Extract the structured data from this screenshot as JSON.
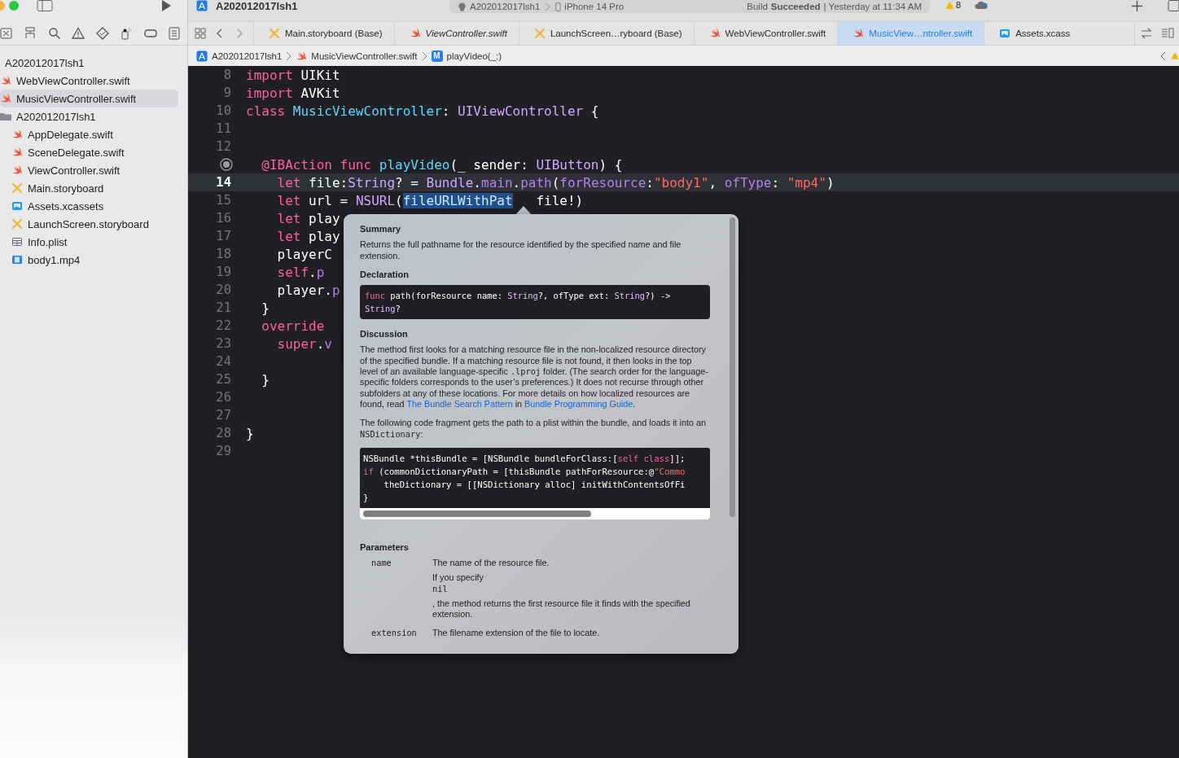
{
  "toolbar": {
    "project_title": "A202012017lsh1",
    "scheme": "A202012017lsh1",
    "device": "iPhone 14 Pro",
    "status": "Build **Succeeded** | Yesterday at 11:34 AM",
    "warning_count": "8"
  },
  "navigator": {
    "items": [
      {
        "kind": "group",
        "label": "A202012017lsh1",
        "selected": false,
        "children": [
          {
            "kind": "swift",
            "label": "WebViewController.swift",
            "selected": false
          },
          {
            "kind": "swift",
            "label": "MusicViewController.swift",
            "selected": true
          },
          {
            "kind": "folder",
            "label": "A202012017lsh1",
            "selected": false,
            "children": [
              {
                "kind": "swift",
                "label": "AppDelegate.swift",
                "selected": false
              },
              {
                "kind": "swift",
                "label": "SceneDelegate.swift",
                "selected": false
              },
              {
                "kind": "swift",
                "label": "ViewController.swift",
                "selected": false
              },
              {
                "kind": "storyboard",
                "label": "Main.storyboard",
                "selected": false
              },
              {
                "kind": "assets",
                "label": "Assets.xcassets",
                "selected": false
              },
              {
                "kind": "storyboard",
                "label": "LaunchScreen.storyboard",
                "selected": false
              },
              {
                "kind": "plist",
                "label": "Info.plist",
                "selected": false
              },
              {
                "kind": "video",
                "label": "body1.mp4",
                "selected": false
              }
            ]
          }
        ]
      }
    ]
  },
  "tabs": [
    {
      "kind": "storyboard",
      "label": "Main.storyboard (Base)",
      "preview": false,
      "selected": false
    },
    {
      "kind": "swift",
      "label": "ViewController.swift",
      "preview": true,
      "selected": false
    },
    {
      "kind": "storyboard",
      "label": "LaunchScreen…ryboard (Base)",
      "preview": false,
      "selected": false
    },
    {
      "kind": "swift",
      "label": "WebViewController.swift",
      "preview": false,
      "selected": false
    },
    {
      "kind": "swift",
      "label": "MusicView…ntroller.swift",
      "preview": false,
      "selected": true
    },
    {
      "kind": "assets",
      "label": "Assets.xcass",
      "preview": false,
      "selected": false
    }
  ],
  "breadcrumb": [
    {
      "kind": "project",
      "label": "A202012017lsh1"
    },
    {
      "kind": "swift",
      "label": "MusicViewController.swift"
    },
    {
      "kind": "method",
      "badge": "M",
      "label": "playVideo(_:)"
    }
  ],
  "editor": {
    "lines": [
      {
        "number": "8",
        "connected": false,
        "current": false,
        "tokens": [
          {
            "kind": "keyword",
            "text": "import"
          },
          {
            "kind": "plain",
            "text": " UIKit"
          }
        ]
      },
      {
        "number": "9",
        "connected": false,
        "current": false,
        "tokens": [
          {
            "kind": "keyword",
            "text": "import"
          },
          {
            "kind": "plain",
            "text": " AVKit"
          }
        ]
      },
      {
        "number": "10",
        "connected": false,
        "current": false,
        "tokens": [
          {
            "kind": "keyword",
            "text": "class"
          },
          {
            "kind": "decl",
            "text": " MusicViewController"
          },
          {
            "kind": "plain",
            "text": ": "
          },
          {
            "kind": "type",
            "text": "UIViewController"
          },
          {
            "kind": "plain",
            "text": " {"
          }
        ]
      },
      {
        "number": "11",
        "connected": false,
        "current": false
      },
      {
        "number": "12",
        "connected": false,
        "current": false
      },
      {
        "connected": true,
        "current": false,
        "tokens": [
          {
            "kind": "keyword",
            "text": "  @IBAction func"
          },
          {
            "kind": "decl",
            "text": " playVideo"
          },
          {
            "kind": "plain",
            "text": "(_ sender: "
          },
          {
            "kind": "type",
            "text": "UIButton"
          },
          {
            "kind": "plain",
            "text": ") {"
          }
        ]
      },
      {
        "number": "14",
        "connected": false,
        "current": true,
        "tokens": [
          {
            "kind": "keyword",
            "text": "    let"
          },
          {
            "kind": "plain",
            "text": " file:"
          },
          {
            "kind": "type",
            "text": "String"
          },
          {
            "kind": "plain",
            "text": "? = "
          },
          {
            "kind": "type",
            "text": "Bundle"
          },
          {
            "kind": "plain",
            "text": "."
          },
          {
            "kind": "member",
            "text": "main"
          },
          {
            "kind": "plain",
            "text": "."
          },
          {
            "kind": "member",
            "text": "path"
          },
          {
            "kind": "plain",
            "text": "("
          },
          {
            "kind": "member",
            "text": "forResource"
          },
          {
            "kind": "plain",
            "text": ":"
          },
          {
            "kind": "string",
            "text": "\"body1\""
          },
          {
            "kind": "plain",
            "text": ", "
          },
          {
            "kind": "member",
            "text": "ofType"
          },
          {
            "kind": "plain",
            "text": ": "
          },
          {
            "kind": "string",
            "text": "\"mp4\""
          },
          {
            "kind": "plain",
            "text": ")"
          }
        ]
      },
      {
        "number": "15",
        "connected": false,
        "current": false,
        "tokens": [
          {
            "kind": "keyword",
            "text": "    let"
          },
          {
            "kind": "plain",
            "text": " url = "
          },
          {
            "kind": "type",
            "text": "NSURL"
          },
          {
            "kind": "plain",
            "text": "("
          },
          {
            "kind": "selected",
            "text": "fileURLWithPat"
          },
          {
            "kind": "plain",
            "text": "   file!)"
          }
        ]
      },
      {
        "number": "16",
        "connected": false,
        "current": false,
        "tokens": [
          {
            "kind": "keyword",
            "text": "    let"
          },
          {
            "kind": "plain",
            "text": " play"
          }
        ]
      },
      {
        "number": "17",
        "connected": false,
        "current": false,
        "tokens": [
          {
            "kind": "keyword",
            "text": "    let"
          },
          {
            "kind": "plain",
            "text": " play"
          }
        ]
      },
      {
        "number": "18",
        "connected": false,
        "current": false,
        "tokens": [
          {
            "kind": "plain",
            "text": "    playerC"
          }
        ]
      },
      {
        "number": "19",
        "connected": false,
        "current": false,
        "tokens": [
          {
            "kind": "keyword",
            "text": "    self"
          },
          {
            "kind": "plain",
            "text": "."
          },
          {
            "kind": "member",
            "text": "p"
          }
        ]
      },
      {
        "number": "20",
        "connected": false,
        "current": false,
        "tokens": [
          {
            "kind": "plain",
            "text": "    player."
          },
          {
            "kind": "member",
            "text": "p"
          }
        ]
      },
      {
        "number": "21",
        "connected": false,
        "current": false,
        "tokens": [
          {
            "kind": "plain",
            "text": "  }"
          }
        ]
      },
      {
        "number": "22",
        "connected": false,
        "current": false,
        "tokens": [
          {
            "kind": "keyword",
            "text": "  override"
          }
        ]
      },
      {
        "number": "23",
        "connected": false,
        "current": false,
        "tokens": [
          {
            "kind": "keyword",
            "text": "    super"
          },
          {
            "kind": "plain",
            "text": "."
          },
          {
            "kind": "member",
            "text": "v"
          }
        ]
      },
      {
        "number": "24",
        "connected": false,
        "current": false
      },
      {
        "number": "25",
        "connected": false,
        "current": false,
        "tokens": [
          {
            "kind": "plain",
            "text": "  }"
          }
        ]
      },
      {
        "number": "26",
        "connected": false,
        "current": false
      },
      {
        "number": "27",
        "connected": false,
        "current": false
      },
      {
        "number": "28",
        "connected": false,
        "current": false,
        "tokens": [
          {
            "kind": "plain",
            "text": "}"
          }
        ]
      },
      {
        "number": "29",
        "connected": false,
        "current": false
      }
    ]
  },
  "quick_help": {
    "blocks": [
      {
        "kind": "heading",
        "text": "Summary"
      },
      {
        "kind": "paragraph",
        "spans": [
          {
            "kind": "text",
            "text": "Returns the full pathname for the resource identified by the specified name and file extension."
          }
        ]
      },
      {
        "kind": "heading",
        "text": "Declaration"
      },
      {
        "kind": "code",
        "lines": [
          [
            {
              "kind": "keyword",
              "text": "func"
            },
            {
              "kind": "plain",
              "text": " path(forResource name: "
            },
            {
              "kind": "type",
              "text": "String"
            },
            {
              "kind": "plain",
              "text": "?, ofType ext: "
            },
            {
              "kind": "type",
              "text": "String"
            },
            {
              "kind": "plain",
              "text": "?) ->"
            }
          ],
          [
            {
              "kind": "type",
              "text": "String"
            },
            {
              "kind": "plain",
              "text": "?"
            }
          ]
        ]
      },
      {
        "kind": "heading",
        "text": "Discussion"
      },
      {
        "kind": "paragraph",
        "spans": [
          {
            "kind": "text",
            "text": "The method first looks for a matching resource file in the non-localized resource directory of the specified bundle. If a matching resource file is not found, it then looks in the top level of an available language-specific "
          },
          {
            "kind": "code",
            "text": ".lproj"
          },
          {
            "kind": "text",
            "text": " folder. (The search order for the language-specific folders corresponds to the user’s preferences.) It does not recurse through other subfolders at any of these locations. For more details on how localized resources are found, read "
          },
          {
            "kind": "link",
            "text": "The Bundle Search Pattern"
          },
          {
            "kind": "text",
            "text": " in "
          },
          {
            "kind": "link",
            "text": "Bundle Programming Guide"
          },
          {
            "kind": "text",
            "text": "."
          }
        ]
      },
      {
        "kind": "paragraph",
        "spans": [
          {
            "kind": "text",
            "text": "The following code fragment gets the path to a plist within the bundle, and loads it into an "
          },
          {
            "kind": "code",
            "text": "NSDictionary"
          },
          {
            "kind": "text",
            "text": ":"
          }
        ]
      },
      {
        "kind": "scroll_code",
        "lines": [
          [
            {
              "kind": "plain",
              "text": "NSBundle *thisBundle = [NSBundle bundleForClass:["
            },
            {
              "kind": "keyword",
              "text": "self class"
            },
            {
              "kind": "plain",
              "text": "]];"
            }
          ],
          [
            {
              "kind": "keyword",
              "text": "if"
            },
            {
              "kind": "plain",
              "text": " (commonDictionaryPath = [thisBundle pathForResource:@"
            },
            {
              "kind": "string",
              "text": "\"Commo"
            }
          ],
          [
            {
              "kind": "plain",
              "text": "    theDictionary = [[NSDictionary alloc] initWithContentsOfFi"
            }
          ],
          [
            {
              "kind": "plain",
              "text": "}"
            }
          ]
        ]
      },
      {
        "kind": "heading",
        "text": "Parameters"
      },
      {
        "kind": "param",
        "name": "name",
        "texts": [
          [
            {
              "kind": "text",
              "text": "The name of the resource file."
            }
          ],
          [
            {
              "kind": "text",
              "text": "If you specify "
            },
            {
              "kind": "code",
              "text": "nil"
            },
            {
              "kind": "text",
              "text": ", the method returns the first resource file it finds with the specified extension."
            }
          ]
        ]
      },
      {
        "kind": "param",
        "name": "extension",
        "texts": [
          [
            {
              "kind": "text",
              "text": "The filename extension of the file to locate."
            }
          ]
        ]
      }
    ]
  }
}
